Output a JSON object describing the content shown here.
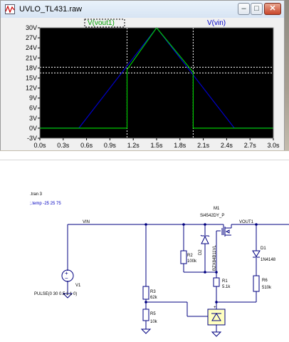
{
  "window": {
    "title": "UVLO_TL431.raw",
    "minimize_glyph": "–",
    "maximize_glyph": "□",
    "close_glyph": "✕"
  },
  "plot": {
    "legend_left": "V(vout1)",
    "legend_right": "V(vin)",
    "colors": {
      "background": "#000000",
      "grid_dash": "#c0c0c0",
      "vout1": "#00c800",
      "vin": "#0000c8",
      "cursor": "#ffffff"
    }
  },
  "chart_data": {
    "type": "line",
    "xlabel": "",
    "ylabel": "",
    "x_ticks": [
      "0.0s",
      "0.3s",
      "0.6s",
      "0.9s",
      "1.2s",
      "1.5s",
      "1.8s",
      "2.1s",
      "2.4s",
      "2.7s",
      "3.0s"
    ],
    "y_ticks": [
      "30V",
      "27V",
      "24V",
      "21V",
      "18V",
      "15V",
      "12V",
      "9V",
      "6V",
      "3V",
      "0V",
      "-3V"
    ],
    "xlim": [
      0,
      3.0
    ],
    "ylim": [
      -3,
      30
    ],
    "series": [
      {
        "name": "V(vin)",
        "points": [
          [
            0,
            0
          ],
          [
            0.5,
            0
          ],
          [
            1.5,
            30
          ],
          [
            2.5,
            0
          ],
          [
            3.0,
            0
          ]
        ]
      },
      {
        "name": "V(vout1)",
        "points": [
          [
            0,
            0
          ],
          [
            1.12,
            0
          ],
          [
            1.12,
            17.5
          ],
          [
            1.5,
            30
          ],
          [
            1.97,
            16.7
          ],
          [
            1.97,
            0
          ],
          [
            3.0,
            0
          ]
        ]
      }
    ],
    "cursors_x": [
      1.12,
      1.97
    ],
    "cursors_y": [
      18.2,
      16.5
    ]
  },
  "schematic": {
    "directives": [
      ".tran 3",
      ";.temp -25 25 75"
    ],
    "net_labels": [
      "VIN",
      "VOUT1"
    ],
    "mosfet": {
      "ref": "M1",
      "value": "Si4542DY_P"
    },
    "zener": {
      "ref": "D2",
      "value": "BZX84B11VL"
    },
    "diode": {
      "ref": "D1",
      "value": "1N4148"
    },
    "source": {
      "ref": "V1",
      "value": "PULSE(0 30 0.5 1 1 0)"
    },
    "resistors": [
      {
        "ref": "R2",
        "value": "100k"
      },
      {
        "ref": "R3",
        "value": "62k"
      },
      {
        "ref": "R5",
        "value": "10k"
      },
      {
        "ref": "R1",
        "value": "5.1k"
      },
      {
        "ref": "R6",
        "value": "510k"
      }
    ]
  }
}
